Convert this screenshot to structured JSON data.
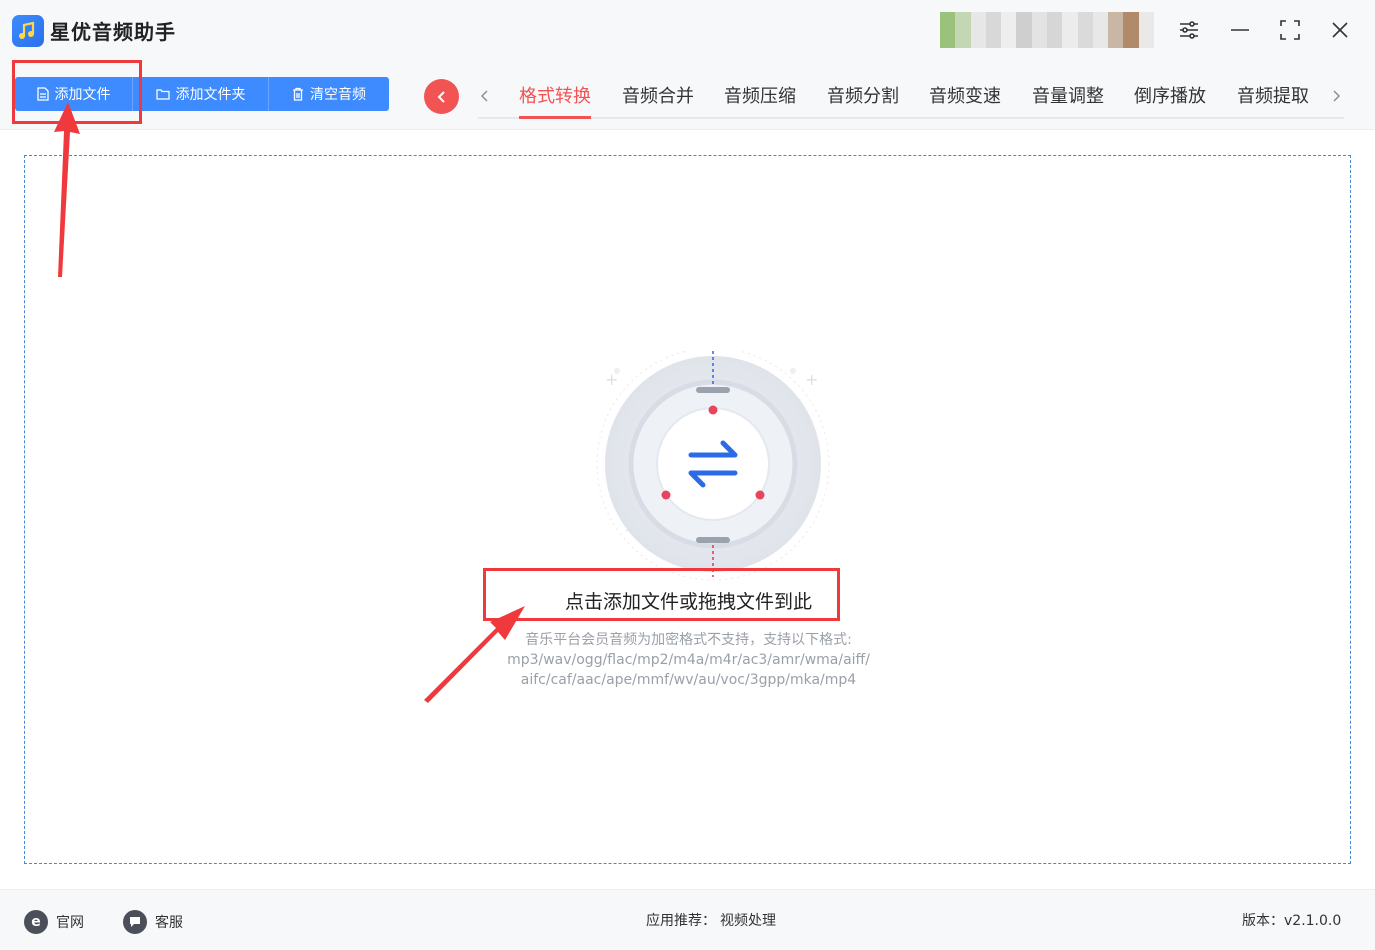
{
  "app": {
    "title": "星优音频助手"
  },
  "toolbar": {
    "add_file": "添加文件",
    "add_folder": "添加文件夹",
    "clear_audio": "清空音频"
  },
  "tabs": [
    {
      "label": "格式转换",
      "active": true
    },
    {
      "label": "音频合并"
    },
    {
      "label": "音频压缩"
    },
    {
      "label": "音频分割"
    },
    {
      "label": "音频变速"
    },
    {
      "label": "音量调整"
    },
    {
      "label": "倒序播放"
    },
    {
      "label": "音频提取"
    }
  ],
  "dropzone": {
    "title": "点击添加文件或拖拽文件到此",
    "note": "音乐平台会员音频为加密格式不支持，支持以下格式:",
    "formats_line1": "mp3/wav/ogg/flac/mp2/m4a/m4r/ac3/amr/wma/aiff/",
    "formats_line2": "aifc/caf/aac/ape/mmf/wv/au/voc/3gpp/mka/mp4"
  },
  "footer": {
    "website": "官网",
    "support": "客服",
    "recommend_label": "应用推荐：",
    "recommend_link": "视频处理",
    "version": "版本：v2.1.0.0"
  },
  "colors": {
    "accent_blue": "#3d8bff",
    "accent_red": "#f25353",
    "annotation_red": "#f0393d"
  }
}
